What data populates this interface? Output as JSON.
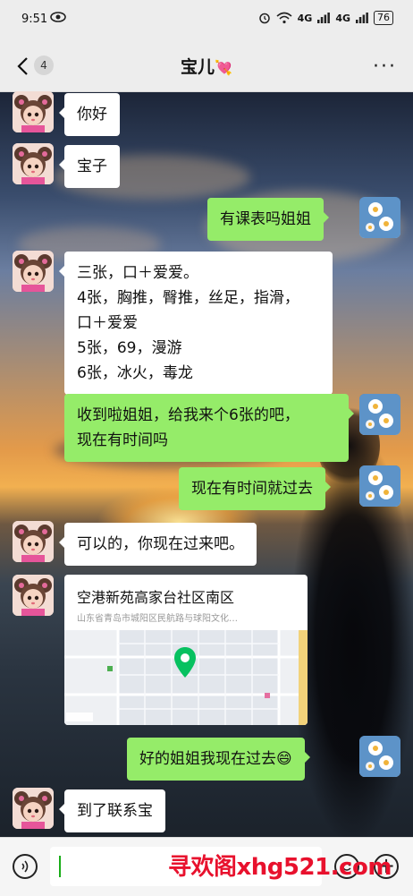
{
  "status_bar": {
    "time": "9:51",
    "network_1": "4G",
    "network_2": "4G",
    "battery": "76"
  },
  "header": {
    "back_count": "4",
    "title": "宝儿",
    "title_emoji": "💘",
    "more_label": "···"
  },
  "messages": [
    {
      "side": "left",
      "lines": [
        "你好"
      ]
    },
    {
      "side": "left",
      "lines": [
        "宝子"
      ]
    },
    {
      "side": "right",
      "lines": [
        "有课表吗姐姐"
      ]
    },
    {
      "side": "left",
      "lines": [
        "三张，口＋爱爱。",
        "4张，胸推，臀推，丝足，指滑，",
        "口＋爱爱",
        "5张，69，漫游",
        "6张，冰火，毒龙"
      ]
    },
    {
      "side": "right",
      "lines": [
        "收到啦姐姐，给我来个6张的吧，",
        "现在有时间吗"
      ]
    },
    {
      "side": "right",
      "lines": [
        "现在有时间就过去"
      ]
    },
    {
      "side": "left",
      "lines": [
        "可以的，你现在过来吧。"
      ]
    },
    {
      "side": "right",
      "lines": [
        "好的姐姐我现在过去😄"
      ]
    },
    {
      "side": "left",
      "lines": [
        "到了联系宝"
      ]
    }
  ],
  "location": {
    "name": "空港新苑高家台社区南区",
    "address": "山东省青岛市城阳区民航路与球阳文化…"
  },
  "input": {
    "value": ""
  },
  "watermark": "寻欢阁xhg521.com",
  "colors": {
    "sent_bubble": "#95ec69",
    "received_bubble": "#ffffff",
    "header_bg": "#ededed",
    "watermark": "#e8112d"
  }
}
